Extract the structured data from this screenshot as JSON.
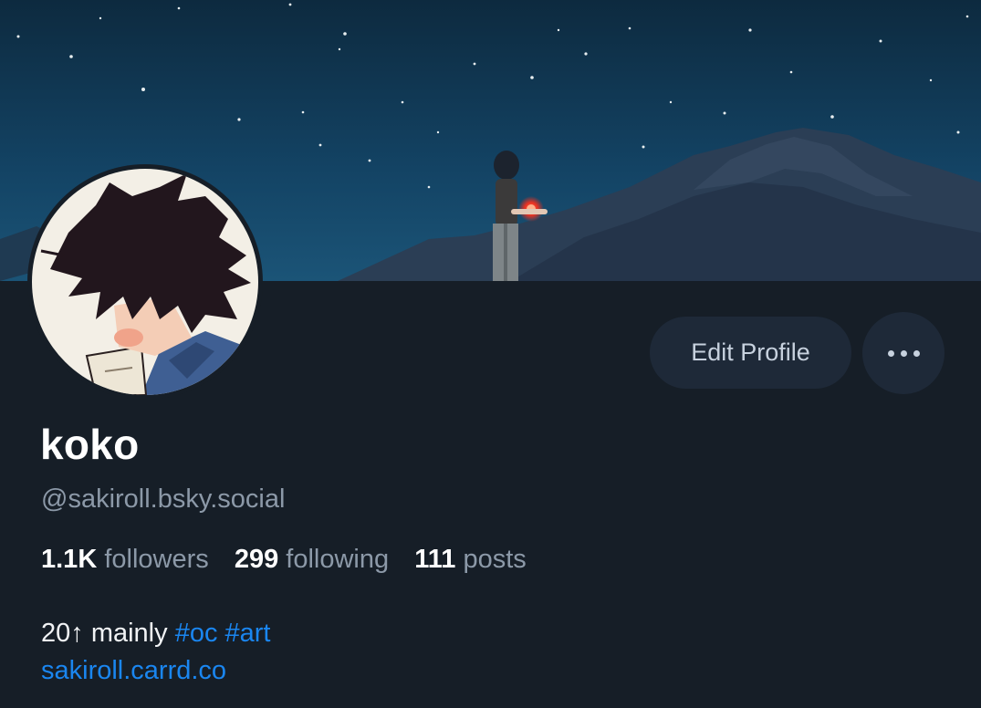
{
  "profile": {
    "display_name": "koko",
    "handle": "@sakiroll.bsky.social",
    "edit_profile_label": "Edit Profile",
    "more_menu_icon": "ellipsis-icon",
    "stats": [
      {
        "count": "1.1K",
        "label": "followers"
      },
      {
        "count": "299",
        "label": "following"
      },
      {
        "count": "111",
        "label": "posts"
      }
    ],
    "bio": {
      "text": "20↑ mainly",
      "hashtags": [
        "#oc",
        "#art"
      ],
      "link": "sakiroll.carrd.co"
    }
  },
  "colors": {
    "background": "#161e27",
    "button_bg": "#1e2938",
    "link": "#1a86f0",
    "muted_text": "#8c99a8"
  }
}
